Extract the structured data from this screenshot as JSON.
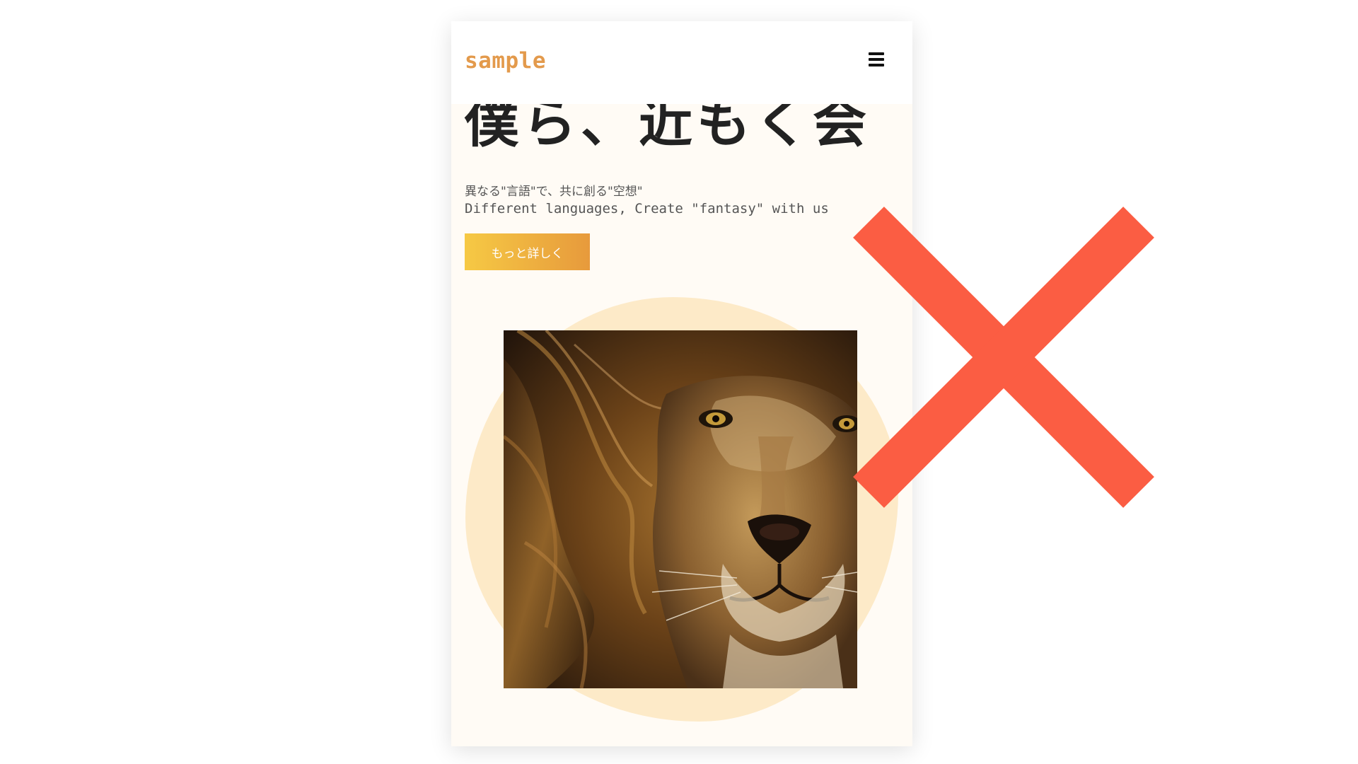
{
  "header": {
    "logo_text": "sample",
    "menu_icon": "hamburger-menu-icon"
  },
  "hero": {
    "heading": "僕ら、近もく会",
    "tagline_jp": "異なる\"言語\"で、共に創る\"空想\"",
    "tagline_en": "Different languages, Create \"fantasy\" with us",
    "cta_label": "もっと詳しく",
    "image_alt": "lion"
  },
  "overlay": {
    "mark_icon": "cross-x-icon"
  },
  "colors": {
    "brand": "#e39a4c",
    "page_background": "#fffbf5",
    "blob": "#fdeac8",
    "cta_start": "#f6c944",
    "cta_end": "#e79a3c",
    "cross": "#fb5d43"
  }
}
